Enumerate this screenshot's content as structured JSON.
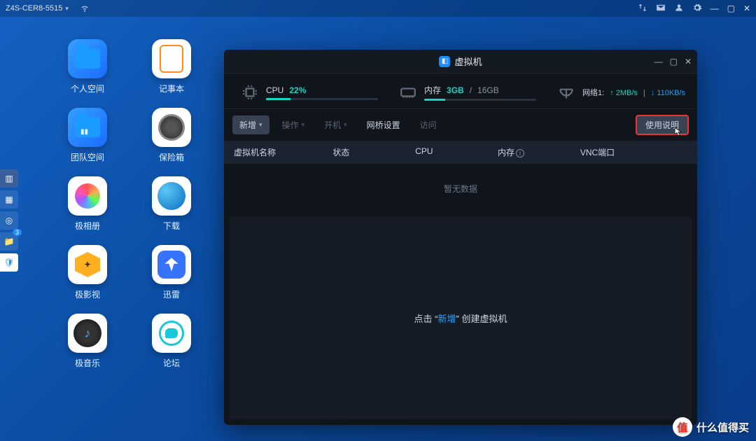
{
  "topbar": {
    "hostname": "Z4S-CER8-5515"
  },
  "desktop": [
    {
      "label": "个人空间"
    },
    {
      "label": "记事本"
    },
    {
      "label": "团队空间"
    },
    {
      "label": "保险箱"
    },
    {
      "label": "极相册"
    },
    {
      "label": "下载"
    },
    {
      "label": "极影视"
    },
    {
      "label": "迅雷"
    },
    {
      "label": "极音乐"
    },
    {
      "label": "论坛"
    }
  ],
  "minibar": {
    "badge_count": "3"
  },
  "vm": {
    "title": "虚拟机",
    "stats": {
      "cpu_label": "CPU",
      "cpu_value": "22%",
      "cpu_pct": 22,
      "mem_label": "内存",
      "mem_used": "3GB",
      "mem_total": "16GB",
      "mem_pct": 19,
      "net_label": "网络1:",
      "net_up": "↑ 2MB/s",
      "net_down": "↓ 110KB/s"
    },
    "toolbar": {
      "new": "新增",
      "ops": "操作",
      "boot": "开机",
      "bridge": "网桥设置",
      "visit": "访问",
      "help": "使用说明"
    },
    "columns": {
      "name": "虚拟机名称",
      "status": "状态",
      "cpu": "CPU",
      "mem": "内存",
      "vnc": "VNC端口"
    },
    "empty": "暂无数据",
    "hint_pre": "点击",
    "hint_q1": "“",
    "hint_hl": "新增",
    "hint_q2": "”",
    "hint_post": "创建虚拟机"
  },
  "watermark": "什么值得买"
}
